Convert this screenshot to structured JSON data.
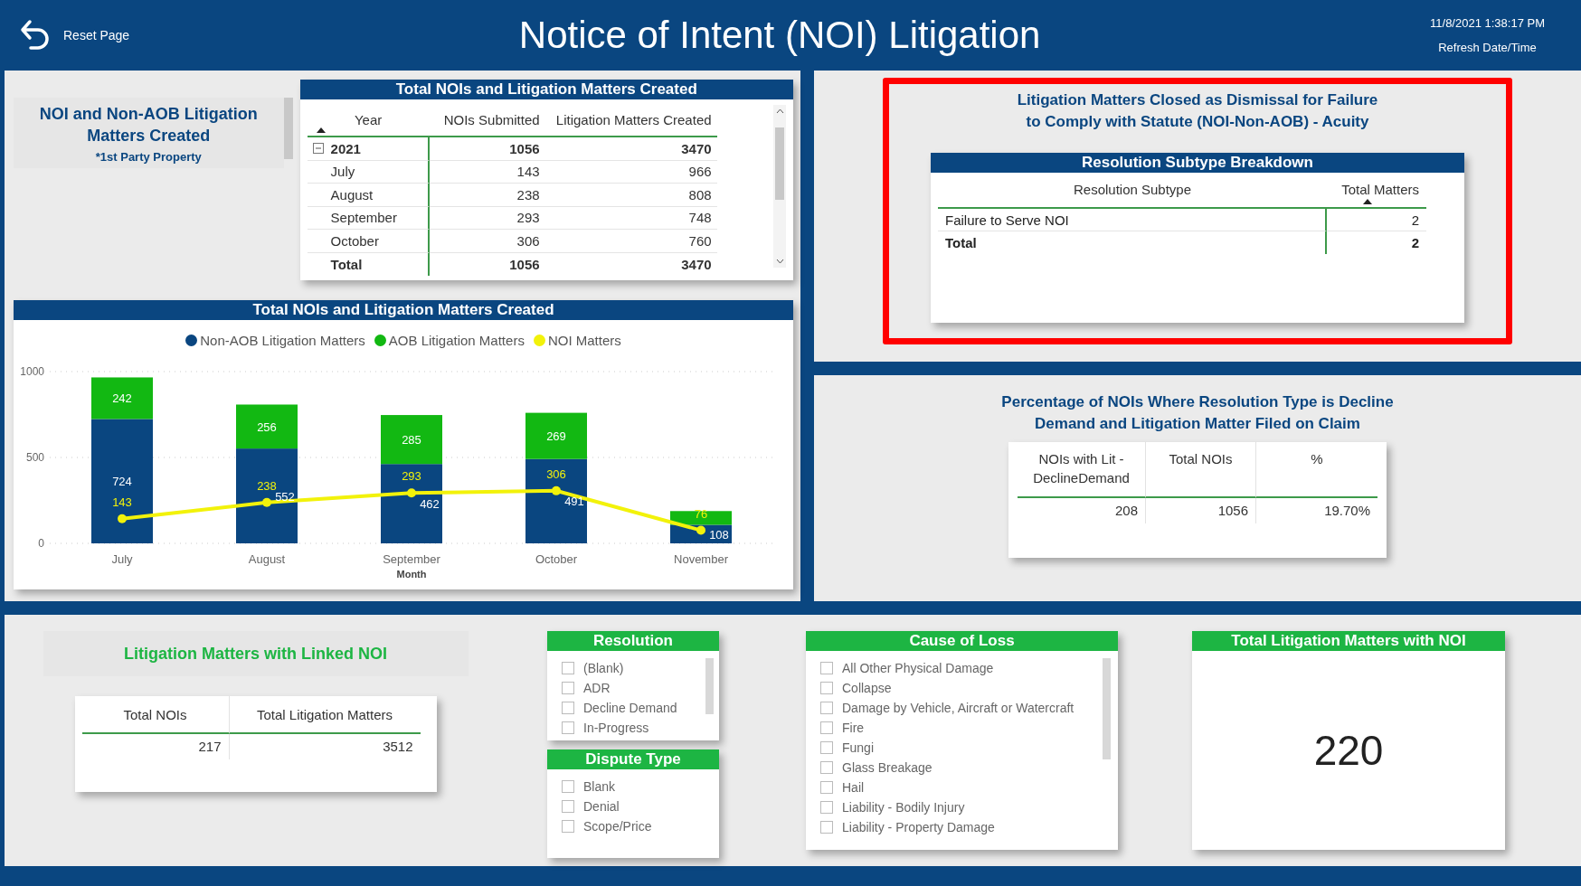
{
  "header": {
    "reset_label": "Reset Page",
    "title": "Notice of Intent (NOI) Litigation",
    "refresh_time": "11/8/2021 1:38:17 PM",
    "refresh_label": "Refresh Date/Time"
  },
  "noi_title_card": {
    "title": "NOI and Non-AOB Litigation Matters Created",
    "subtitle": "*1st Party Property"
  },
  "matrix": {
    "title": "Total NOIs and Litigation Matters Created",
    "columns": [
      {
        "label": "Year",
        "sorted": true
      },
      {
        "label": "NOIs Submitted",
        "sorted": false
      },
      {
        "label": "Litigation Matters Created",
        "sorted": false
      }
    ],
    "group": {
      "label": "2021",
      "expanded": true,
      "values": [
        "1056",
        "3470"
      ]
    },
    "rows": [
      {
        "label": "July",
        "values": [
          "143",
          "966"
        ]
      },
      {
        "label": "August",
        "values": [
          "238",
          "808"
        ]
      },
      {
        "label": "September",
        "values": [
          "293",
          "748"
        ]
      },
      {
        "label": "October",
        "values": [
          "306",
          "760"
        ]
      }
    ],
    "total": {
      "label": "Total",
      "values": [
        "1056",
        "3470"
      ]
    }
  },
  "chart": {
    "title": "Total NOIs and Litigation Matters Created",
    "chart_data": {
      "type": "bar",
      "stacked": true,
      "xlabel": "Month",
      "categories": [
        "July",
        "August",
        "September",
        "October",
        "November"
      ],
      "ylim": [
        0,
        1000
      ],
      "yticks": [
        0,
        500,
        1000
      ],
      "series": [
        {
          "name": "Non-AOB Litigation Matters",
          "color": "#0a4680",
          "type": "bar",
          "values": [
            724,
            552,
            462,
            491,
            108
          ]
        },
        {
          "name": "AOB Litigation Matters",
          "color": "#12b812",
          "type": "bar",
          "values": [
            242,
            256,
            285,
            269,
            80
          ]
        },
        {
          "name": "NOI Matters",
          "color": "#f2f20a",
          "type": "line",
          "marker": "circle",
          "values": [
            143,
            238,
            293,
            306,
            76
          ]
        }
      ],
      "value_labels": [
        [
          "724",
          "552",
          "462",
          "491",
          "108"
        ],
        [
          "242",
          "256",
          "285",
          "269",
          null
        ],
        [
          "143",
          "238",
          "293",
          "306",
          "76"
        ]
      ]
    }
  },
  "dismissal": {
    "highlighted": true,
    "title_lines": [
      "Litigation Matters Closed as Dismissal for Failure",
      "to Comply with Statute (NOI-Non-AOB) - Acuity"
    ],
    "table": {
      "title": "Resolution Subtype Breakdown",
      "columns": [
        {
          "label": "Resolution Subtype",
          "sorted": false
        },
        {
          "label": "Total Matters",
          "sorted": true
        }
      ],
      "rows": [
        [
          "Failure to Serve NOI",
          "2"
        ]
      ],
      "total": [
        "Total",
        "2"
      ]
    }
  },
  "decline": {
    "title_lines": [
      "Percentage of NOIs Where Resolution Type is Decline",
      "Demand and Litigation Matter Filed on Claim"
    ],
    "columns": [
      "NOIs with Lit - DeclineDemand",
      "Total NOIs",
      "%"
    ],
    "values": [
      "208",
      "1056",
      "19.70%"
    ]
  },
  "linked": {
    "title": "Litigation Matters with Linked NOI",
    "columns": [
      "Total NOIs",
      "Total Litigation Matters"
    ],
    "values": [
      "217",
      "3512"
    ]
  },
  "slicers": [
    {
      "title": "Resolution",
      "items": [
        {
          "label": "(Blank)",
          "checked": false
        },
        {
          "label": "ADR",
          "checked": false
        },
        {
          "label": "Decline Demand",
          "checked": false
        },
        {
          "label": "In-Progress",
          "checked": false
        }
      ]
    },
    {
      "title": "Dispute Type",
      "items": [
        {
          "label": "Blank",
          "checked": false
        },
        {
          "label": "Denial",
          "checked": false
        },
        {
          "label": "Scope/Price",
          "checked": false
        }
      ]
    },
    {
      "title": "Cause of Loss",
      "items": [
        {
          "label": "All Other Physical Damage",
          "checked": false
        },
        {
          "label": "Collapse",
          "checked": false
        },
        {
          "label": "Damage by Vehicle, Aircraft or Watercraft",
          "checked": false
        },
        {
          "label": "Fire",
          "checked": false
        },
        {
          "label": "Fungi",
          "checked": false
        },
        {
          "label": "Glass Breakage",
          "checked": false
        },
        {
          "label": "Hail",
          "checked": false
        },
        {
          "label": "Liability - Bodily Injury",
          "checked": false
        },
        {
          "label": "Liability - Property Damage",
          "checked": false
        }
      ]
    }
  ],
  "kpi": {
    "title": "Total Litigation Matters with NOI",
    "value": "220"
  }
}
